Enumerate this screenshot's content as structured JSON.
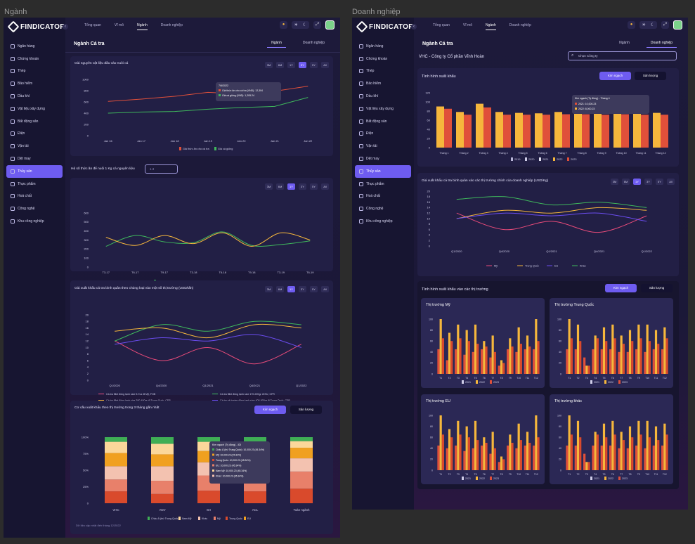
{
  "frames": {
    "left_label": "Ngành",
    "right_label": "Doanh nghiệp"
  },
  "brand": {
    "name": "FINDICATOR"
  },
  "nav": [
    "Ngân hàng",
    "Chứng khoán",
    "Thép",
    "Bảo hiểm",
    "Dầu khí",
    "Vật liệu xây dựng",
    "Bất động sản",
    "Điện",
    "Vận tải",
    "Dệt may",
    "Thủy sản",
    "Thực phẩm",
    "Hoá chất",
    "Công nghệ",
    "Khu công nghiệp"
  ],
  "nav_active": 10,
  "top_tabs": [
    "Tổng quan",
    "Vĩ mô",
    "Ngành",
    "Doanh nghiệp"
  ],
  "top_tab_active": 2,
  "page": {
    "title": "Ngành Cá tra",
    "subtabs": [
      "Ngành",
      "Doanh nghiệp"
    ]
  },
  "ranges6": [
    "3M",
    "6M",
    "1Y",
    "3Y",
    "5Y",
    "All"
  ],
  "ranges6b": [
    "3M",
    "6M",
    "1Y",
    "3Y",
    "5Y",
    "All"
  ],
  "colors": {
    "accent": "#6e5cf0",
    "red": "#e0503a",
    "green": "#3fb85c",
    "yellow": "#f6b73c",
    "purple": "#6b4df0",
    "pink": "#e94b7a",
    "peach": "#f6c7a8",
    "orange": "#f39c12",
    "brown": "#b5522c"
  },
  "left": {
    "chart1": {
      "title": "Giá nguyên vật liệu đầu vào nuôi cá",
      "yticks": [
        "1000",
        "800",
        "600",
        "400",
        "200",
        "0"
      ],
      "xticks": [
        "Jan 16",
        "Jan 17",
        "Jan 18",
        "Jan 19",
        "Jan 20",
        "Jan 21",
        "Jan 22"
      ],
      "legend": [
        "Giá thức ăn cho cá tra",
        "Giá cá giống"
      ],
      "tooltip": {
        "date": "7/6/2022",
        "line1": "Giá thức ăn cho cá tra (VND): 12,304",
        "line2": "Giá cá giống (VND): 1,205.24"
      }
    },
    "ratio": {
      "label": "Hệ số thức ăn để nuôi 1 Kg cá nguyên liệu",
      "placeholder": "1.3"
    },
    "chart2": {
      "yticks": [
        "600",
        "500",
        "400",
        "300",
        "200",
        "100",
        "0"
      ],
      "xticks": [
        "T3-17",
        "T6-17",
        "T9-17",
        "T3-18",
        "T6-18",
        "T9-18",
        "T3-19",
        "T6-19"
      ],
      "legend": [
        "Giá cá nguyên liệu (Giá bán)",
        "Giá vốn nuôi cá nông dân"
      ]
    },
    "chart3": {
      "title": "Giá xuất khẩu cá tra bình quân theo chủng loại vào một số thị trường (USD/tấn)",
      "yticks": [
        "20",
        "18",
        "16",
        "14",
        "12",
        "10",
        "8",
        "6",
        "4",
        "2",
        "0"
      ],
      "xticks": [
        "Q1/2020",
        "Q4/2020",
        "Q1/2021",
        "Q4/2021",
        "Q1/2022"
      ],
      "legend": [
        "Cá tra fillet đông lạnh size 5-7oz đi Mỹ, FOB",
        "Cá tra fillet đông lạnh size 170-220gr đi EU, CFR",
        "Cá tra fillet đông lạnh size 380-400gr đi Trung Quốc, CFR",
        "Cá tra xẻ bướm đông lạnh size 400-600gr đi Trung Quốc, CFR"
      ]
    },
    "chart4": {
      "title": "Cơ cấu xuất khẩu theo thị trường trong 3 tháng gần nhất",
      "btn_primary": "Kim ngạch",
      "btn_secondary": "Sản lượng",
      "yticks": [
        "100%",
        "75%",
        "50%",
        "25%",
        "0"
      ],
      "categories": [
        "VHC",
        "ANV",
        "IDI",
        "ACL",
        "Toàn ngành"
      ],
      "legend": [
        "Châu Á (trừ Trung Quốc)",
        "Nam Mỹ",
        "Khác",
        "Mỹ",
        "Trung Quốc",
        "EU"
      ],
      "footnote": "Dữ liệu cập nhật đến tháng 12/2022",
      "tooltip": {
        "title": "Kim ngạch (Tỷ đồng) - IDI",
        "lines": [
          "Châu Á (trừ Trung Quốc): 10,000.23 (45.34%)",
          "Mỹ: 10,000.23 (45.34%)",
          "Trung Quốc: 10,000.23 (45.34%)",
          "EU: 10,000.23 (45.34%)",
          "Nam Mỹ: 10,000.23 (45.34%)",
          "Khác: 10,000.23 (45.34%)"
        ]
      }
    }
  },
  "right": {
    "company": "VHC - Công ty Cổ phần Vĩnh Hoàn",
    "search_placeholder": "Chọn Công ty",
    "export": {
      "title": "Tình hình xuất khẩu",
      "btn_primary": "Kim ngạch",
      "btn_secondary": "Sản lượng",
      "yticks": [
        "120",
        "100",
        "80",
        "60",
        "40",
        "20",
        "0"
      ],
      "xticks": [
        "Tháng 1",
        "Tháng 2",
        "Tháng 3",
        "Tháng 4",
        "Tháng 5",
        "Tháng 6",
        "Tháng 7",
        "Tháng 8",
        "Tháng 9",
        "Tháng 10",
        "Tháng 11",
        "Tháng 12"
      ],
      "legend": [
        "2019",
        "2020",
        "2021",
        "2022",
        "2023"
      ],
      "tooltip": {
        "title": "Kim ngạch (Tỷ đồng) - Tháng 4",
        "line1": "2021: 10,000.23",
        "line2": "2022: 8,000.23"
      }
    },
    "avgprice": {
      "title": "Giá xuất khẩu cá tra bình quân vào các thị trường chính của doanh nghiệp (USD/Kg)",
      "yticks": [
        "20",
        "18",
        "16",
        "14",
        "12",
        "10",
        "8",
        "6",
        "4",
        "2",
        "0"
      ],
      "xticks": [
        "Q1/2020",
        "Q4/2020",
        "Q1/2021",
        "Q4/2021",
        "Q1/2022"
      ],
      "legend": [
        "Mỹ",
        "Trung Quốc",
        "EU",
        "Khác"
      ]
    },
    "markets": {
      "title": "Tình hình xuất khẩu vào các thị trường",
      "btn_primary": "Kim ngạch",
      "btn_secondary": "Sản lượng",
      "panels": [
        "Thị trường Mỹ",
        "Thị trường Trung Quốc",
        "Thị trường EU",
        "Thị trường khác"
      ],
      "yticks": [
        "100",
        "80",
        "60",
        "40",
        "20",
        "0"
      ],
      "xticks": [
        "T1",
        "T2",
        "T3",
        "T4",
        "T5",
        "T6",
        "T7",
        "T8",
        "T9",
        "T10",
        "T11",
        "T12"
      ],
      "legend": [
        "2021",
        "2022",
        "2023"
      ]
    }
  },
  "chart_data": [
    {
      "type": "line",
      "title": "Giá nguyên vật liệu đầu vào nuôi cá",
      "x": [
        "Jan 16",
        "Jan 17",
        "Jan 18",
        "Jan 19",
        "Jan 20",
        "Jan 21",
        "Jan 22"
      ],
      "ylim": [
        0,
        1000
      ],
      "series": [
        {
          "name": "Giá thức ăn cho cá tra",
          "values": [
            610,
            650,
            700,
            770,
            740,
            790,
            880
          ]
        },
        {
          "name": "Giá cá giống",
          "values": [
            400,
            420,
            430,
            470,
            500,
            520,
            680
          ]
        }
      ]
    },
    {
      "type": "line",
      "x": [
        "T3-17",
        "T6-17",
        "T9-17",
        "T3-18",
        "T6-18",
        "T9-18",
        "T3-19",
        "T6-19"
      ],
      "ylim": [
        0,
        600
      ],
      "series": [
        {
          "name": "Giá cá nguyên liệu (Giá bán)",
          "values": [
            230,
            350,
            280,
            270,
            390,
            240,
            250,
            290
          ]
        },
        {
          "name": "Giá vốn nuôi cá nông dân",
          "values": [
            330,
            240,
            350,
            260,
            380,
            230,
            380,
            300
          ]
        }
      ]
    },
    {
      "type": "line",
      "title": "Giá xuất khẩu cá tra bình quân theo chủng loại vào một số thị trường (USD/tấn)",
      "x": [
        "Q1/2020",
        "Q4/2020",
        "Q1/2021",
        "Q4/2021",
        "Q1/2022"
      ],
      "ylim": [
        0,
        20
      ],
      "series": [
        {
          "name": "Cá tra fillet đông lạnh size 5-7oz đi Mỹ, FOB",
          "values": [
            12,
            6,
            10,
            5,
            11
          ]
        },
        {
          "name": "Cá tra fillet đông lạnh size 170-220gr đi EU, CFR",
          "values": [
            12,
            17,
            15,
            18,
            17
          ]
        },
        {
          "name": "Cá tra fillet đông lạnh size 380-400gr đi Trung Quốc, CFR",
          "values": [
            15,
            16,
            13,
            17,
            16
          ]
        },
        {
          "name": "Cá tra xẻ bướm đông lạnh size 400-600gr đi Trung Quốc, CFR",
          "values": [
            11,
            13,
            12,
            14,
            10
          ]
        }
      ]
    },
    {
      "type": "bar",
      "title": "Cơ cấu xuất khẩu theo thị trường trong 3 tháng gần nhất",
      "categories": [
        "VHC",
        "ANV",
        "IDI",
        "ACL",
        "Toàn ngành"
      ],
      "ylim": [
        0,
        100
      ],
      "series": [
        {
          "name": "EU",
          "values": [
            18,
            14,
            19,
            18,
            22
          ]
        },
        {
          "name": "Trung Quốc",
          "values": [
            18,
            20,
            23,
            24,
            26
          ]
        },
        {
          "name": "Mỹ",
          "values": [
            20,
            22,
            20,
            16,
            20
          ]
        },
        {
          "name": "Khác",
          "values": [
            20,
            18,
            17,
            22,
            16
          ]
        },
        {
          "name": "Nam Mỹ",
          "values": [
            17,
            16,
            14,
            12,
            10
          ]
        },
        {
          "name": "Châu Á (trừ Trung Quốc)",
          "values": [
            7,
            10,
            7,
            8,
            6
          ]
        }
      ]
    },
    {
      "type": "bar",
      "title": "Tình hình xuất khẩu",
      "categories": [
        "Tháng 1",
        "Tháng 2",
        "Tháng 3",
        "Tháng 4",
        "Tháng 5",
        "Tháng 6",
        "Tháng 7",
        "Tháng 8",
        "Tháng 9",
        "Tháng 10",
        "Tháng 11",
        "Tháng 12"
      ],
      "ylim": [
        0,
        120
      ],
      "series": [
        {
          "name": "2022",
          "values": [
            90,
            78,
            96,
            78,
            76,
            75,
            78,
            78,
            76,
            77,
            75,
            76
          ]
        },
        {
          "name": "2023",
          "values": [
            85,
            72,
            88,
            72,
            72,
            72,
            73,
            73,
            72,
            73,
            72,
            72
          ]
        }
      ]
    },
    {
      "type": "line",
      "title": "Giá xuất khẩu cá tra bình quân vào các thị trường chính của doanh nghiệp (USD/Kg)",
      "x": [
        "Q1/2020",
        "Q4/2020",
        "Q1/2021",
        "Q4/2021",
        "Q1/2022"
      ],
      "ylim": [
        0,
        20
      ],
      "series": [
        {
          "name": "Mỹ",
          "values": [
            12,
            6,
            9,
            5,
            11
          ]
        },
        {
          "name": "Trung Quốc",
          "values": [
            10,
            13,
            12,
            14,
            13
          ]
        },
        {
          "name": "EU",
          "values": [
            10,
            12,
            11,
            12,
            9
          ]
        },
        {
          "name": "Khác",
          "values": [
            17,
            18,
            15,
            16,
            14
          ]
        }
      ]
    },
    {
      "type": "bar",
      "title": "Thị trường Mỹ",
      "categories": [
        "T1",
        "T2",
        "T3",
        "T4",
        "T5",
        "T6",
        "T7",
        "T8",
        "T9",
        "T10",
        "T11",
        "T12"
      ],
      "ylim": [
        0,
        100
      ],
      "series": [
        {
          "name": "2021",
          "values": [
            45,
            25,
            45,
            35,
            40,
            45,
            30,
            15,
            45,
            40,
            45,
            45
          ]
        },
        {
          "name": "2022",
          "values": [
            100,
            75,
            90,
            80,
            90,
            60,
            70,
            25,
            65,
            85,
            70,
            100
          ]
        },
        {
          "name": "2023",
          "values": [
            65,
            60,
            65,
            60,
            55,
            50,
            40,
            20,
            50,
            55,
            50,
            60
          ]
        }
      ]
    },
    {
      "type": "bar",
      "title": "Thị trường Trung Quốc",
      "categories": [
        "T1",
        "T2",
        "T3",
        "T4",
        "T5",
        "T6",
        "T7",
        "T8",
        "T9",
        "T10",
        "T11",
        "T12"
      ],
      "ylim": [
        0,
        100
      ],
      "series": [
        {
          "name": "2021",
          "values": [
            45,
            45,
            30,
            45,
            45,
            45,
            40,
            40,
            45,
            40,
            45,
            45
          ]
        },
        {
          "name": "2022",
          "values": [
            100,
            90,
            15,
            70,
            85,
            90,
            70,
            80,
            90,
            90,
            80,
            85
          ]
        },
        {
          "name": "2023",
          "values": [
            65,
            60,
            15,
            65,
            60,
            65,
            55,
            60,
            65,
            60,
            55,
            65
          ]
        }
      ]
    },
    {
      "type": "bar",
      "title": "Thị trường EU",
      "categories": [
        "T1",
        "T2",
        "T3",
        "T4",
        "T5",
        "T6",
        "T7",
        "T8",
        "T9",
        "T10",
        "T11",
        "T12"
      ],
      "ylim": [
        0,
        100
      ],
      "series": [
        {
          "name": "2021",
          "values": [
            45,
            40,
            45,
            35,
            40,
            45,
            30,
            15,
            45,
            40,
            45,
            45
          ]
        },
        {
          "name": "2022",
          "values": [
            100,
            75,
            90,
            80,
            90,
            60,
            70,
            25,
            65,
            85,
            70,
            100
          ]
        },
        {
          "name": "2023",
          "values": [
            65,
            60,
            65,
            60,
            55,
            50,
            40,
            20,
            50,
            55,
            50,
            60
          ]
        }
      ]
    },
    {
      "type": "bar",
      "title": "Thị trường khác",
      "categories": [
        "T1",
        "T2",
        "T3",
        "T4",
        "T5",
        "T6",
        "T7",
        "T8",
        "T9",
        "T10",
        "T11",
        "T12"
      ],
      "ylim": [
        0,
        100
      ],
      "series": [
        {
          "name": "2021",
          "values": [
            45,
            45,
            30,
            45,
            45,
            45,
            40,
            40,
            45,
            40,
            45,
            45
          ]
        },
        {
          "name": "2022",
          "values": [
            100,
            90,
            15,
            70,
            85,
            90,
            70,
            80,
            90,
            90,
            80,
            85
          ]
        },
        {
          "name": "2023",
          "values": [
            65,
            60,
            15,
            65,
            60,
            65,
            55,
            60,
            65,
            60,
            55,
            65
          ]
        }
      ]
    }
  ]
}
